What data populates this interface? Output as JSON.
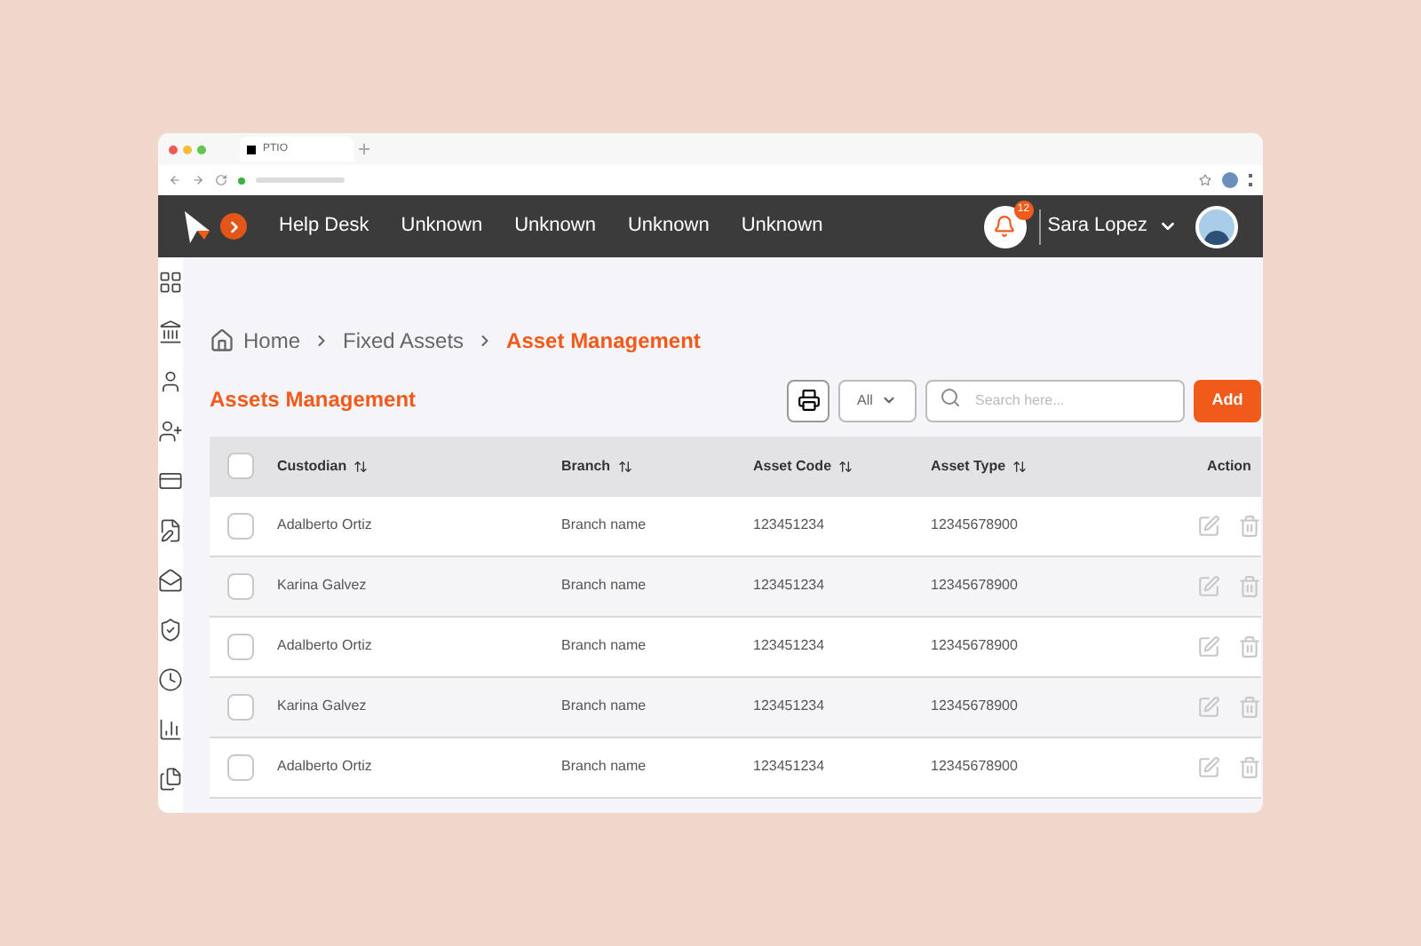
{
  "browser": {
    "tab_title": "PTIO"
  },
  "nav": {
    "items": [
      "Help Desk",
      "Unknown",
      "Unknown",
      "Unknown",
      "Unknown"
    ],
    "notifications": "12",
    "user": "Sara Lopez"
  },
  "breadcrumb": [
    {
      "label": "Home",
      "selected": false
    },
    {
      "label": "Fixed Assets",
      "selected": false
    },
    {
      "label": "Asset Management",
      "selected": true
    }
  ],
  "page_title": "Assets Management",
  "toolbar": {
    "filter": "All",
    "search_placeholder": "Search here...",
    "add": "Add"
  },
  "table": {
    "select_all_checked": false,
    "columns": [
      {
        "label": "Custodian",
        "sortable": true
      },
      {
        "label": "Branch",
        "sortable": true
      },
      {
        "label": "Asset Code",
        "sortable": true
      },
      {
        "label": "Asset Type",
        "sortable": true
      },
      {
        "label": "Action",
        "sortable": false
      }
    ],
    "rows": [
      {
        "checked": false,
        "cells": [
          "Adalberto Ortiz",
          "Branch name",
          "123451234",
          "12345678900"
        ]
      },
      {
        "checked": false,
        "cells": [
          "Karina Galvez",
          "Branch name",
          "123451234",
          "12345678900"
        ]
      },
      {
        "checked": false,
        "cells": [
          "Adalberto Ortiz",
          "Branch name",
          "123451234",
          "12345678900"
        ]
      },
      {
        "checked": false,
        "cells": [
          "Karina Galvez",
          "Branch name",
          "123451234",
          "12345678900"
        ]
      },
      {
        "checked": false,
        "cells": [
          "Adalberto Ortiz",
          "Branch name",
          "123451234",
          "12345678900"
        ]
      }
    ]
  }
}
